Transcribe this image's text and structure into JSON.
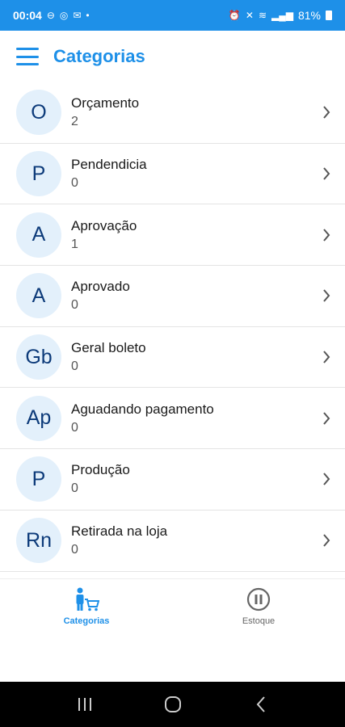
{
  "status_bar": {
    "time": "00:04",
    "battery": "81%"
  },
  "header": {
    "title": "Categorias"
  },
  "categories": [
    {
      "initials": "O",
      "name": "Orçamento",
      "count": "2"
    },
    {
      "initials": "P",
      "name": "Pendendicia",
      "count": "0"
    },
    {
      "initials": "A",
      "name": "Aprovação",
      "count": "1"
    },
    {
      "initials": "A",
      "name": "Aprovado",
      "count": "0"
    },
    {
      "initials": "Gb",
      "name": "Geral boleto",
      "count": "0"
    },
    {
      "initials": "Ap",
      "name": "Aguadando pagamento",
      "count": "0"
    },
    {
      "initials": "P",
      "name": "Produção",
      "count": "0"
    },
    {
      "initials": "Rn",
      "name": "Retirada na loja",
      "count": "0"
    }
  ],
  "tabs": [
    {
      "label": "Categorias",
      "icon": "person-cart-icon",
      "active": true
    },
    {
      "label": "Estoque",
      "icon": "pause-circle-icon",
      "active": false
    }
  ],
  "colors": {
    "primary": "#1e90e8",
    "avatar_bg": "#e3f0fb",
    "avatar_text": "#0d3b7a"
  }
}
